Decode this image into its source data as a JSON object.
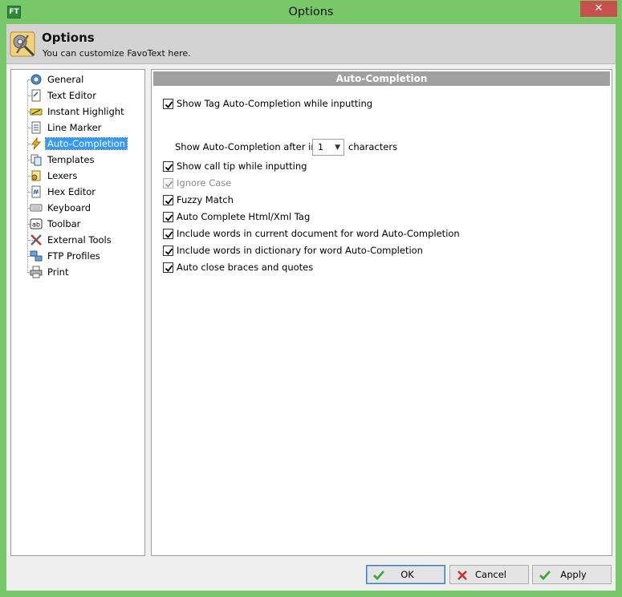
{
  "window": {
    "title": "Options",
    "app_icon_text": "FT",
    "close_glyph": "✕"
  },
  "header": {
    "title": "Options",
    "subtitle": "You can customize FavoText here.",
    "icon": "settings-tools-icon"
  },
  "tree": {
    "items": [
      {
        "label": "General",
        "icon": "gear-icon"
      },
      {
        "label": "Text Editor",
        "icon": "document-icon"
      },
      {
        "label": "Instant Highlight",
        "icon": "highlighter-icon"
      },
      {
        "label": "Line Marker",
        "icon": "line-marker-icon"
      },
      {
        "label": "Auto-Completion",
        "icon": "lightning-icon",
        "selected": true
      },
      {
        "label": "Templates",
        "icon": "templates-icon"
      },
      {
        "label": "Lexers",
        "icon": "lexers-icon"
      },
      {
        "label": "Hex Editor",
        "icon": "hex-icon"
      },
      {
        "label": "Keyboard",
        "icon": "keyboard-icon"
      },
      {
        "label": "Toolbar",
        "icon": "toolbar-icon"
      },
      {
        "label": "External Tools",
        "icon": "tools-icon"
      },
      {
        "label": "FTP Profiles",
        "icon": "network-icon"
      },
      {
        "label": "Print",
        "icon": "printer-icon"
      }
    ]
  },
  "panel": {
    "title": "Auto-Completion",
    "options": [
      {
        "label": "Show Tag Auto-Completion while inputting",
        "checked": true,
        "disabled": false
      },
      {
        "label": "Show call tip while inputting",
        "checked": true,
        "disabled": false
      },
      {
        "label": "Ignore Case",
        "checked": true,
        "disabled": true
      },
      {
        "label": "Fuzzy Match",
        "checked": true,
        "disabled": false
      },
      {
        "label": "Auto Complete Html/Xml Tag",
        "checked": true,
        "disabled": false
      },
      {
        "label": "Include words in current document for word Auto-Completion",
        "checked": true,
        "disabled": false
      },
      {
        "label": "Include words in dictionary for word Auto-Completion",
        "checked": true,
        "disabled": false
      },
      {
        "label": "Auto close braces and quotes",
        "checked": true,
        "disabled": false
      }
    ],
    "after_input": {
      "label": "Show Auto-Completion after input",
      "value": "1",
      "unit": "characters"
    }
  },
  "buttons": {
    "ok": "OK",
    "cancel": "Cancel",
    "apply": "Apply"
  }
}
